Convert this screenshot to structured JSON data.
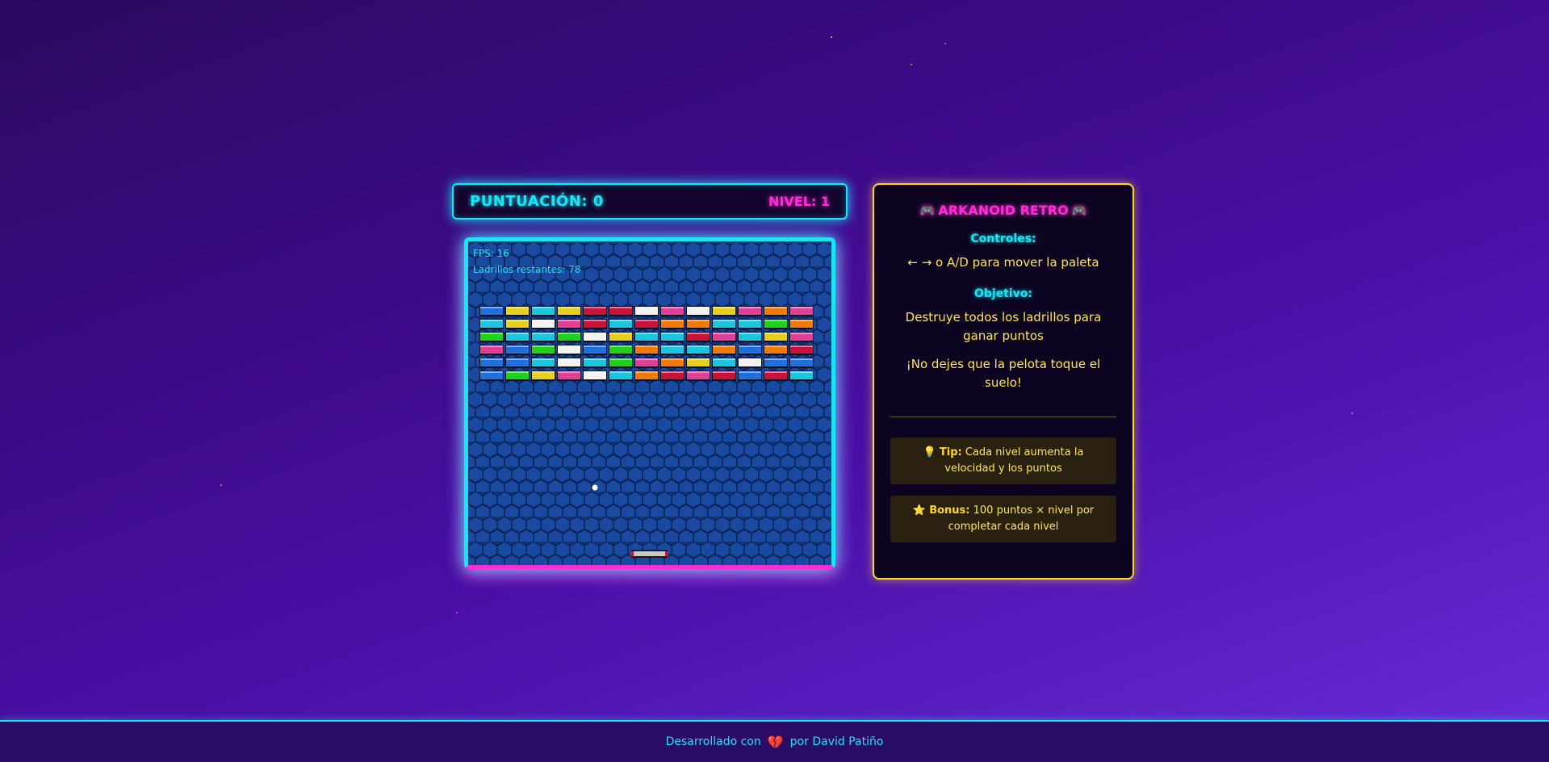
{
  "header": {
    "score_label": "PUNTUACIÓN: 0",
    "level_label": "NIVEL: 1"
  },
  "game": {
    "fps_label": "FPS: 16",
    "bricks_label": "Ladrillos restantes: 78",
    "brick_rows": [
      [
        "blue",
        "yellow",
        "cyan",
        "yellow",
        "red",
        "red",
        "white",
        "pink",
        "white",
        "yellow",
        "pink",
        "orange",
        "pink"
      ],
      [
        "cyan",
        "yellow",
        "white",
        "pink",
        "red",
        "cyan",
        "red",
        "orange",
        "orange",
        "cyan",
        "cyan",
        "green",
        "orange"
      ],
      [
        "green",
        "cyan",
        "cyan",
        "green",
        "white",
        "yellow",
        "cyan",
        "cyan",
        "red",
        "pink",
        "cyan",
        "yellow",
        "pink"
      ],
      [
        "pink",
        "blue",
        "green",
        "white",
        "blue",
        "green",
        "orange",
        "cyan",
        "cyan",
        "orange",
        "blue",
        "orange",
        "red"
      ],
      [
        "blue",
        "blue",
        "cyan",
        "white",
        "cyan",
        "green",
        "pink",
        "orange",
        "yellow",
        "cyan",
        "white",
        "blue",
        "blue"
      ],
      [
        "blue",
        "green",
        "yellow",
        "pink",
        "white",
        "cyan",
        "orange",
        "red",
        "pink",
        "red",
        "blue",
        "red",
        "cyan"
      ]
    ],
    "ball_color": "#ffffff",
    "paddle_color": "#c8c8c8"
  },
  "info": {
    "title": "ARKANOID RETRO",
    "title_icon": "gamepad-icon",
    "controls_title": "Controles:",
    "controls_text": "← → o A/D para mover la paleta",
    "objective_title": "Objetivo:",
    "objective_text_1": "Destruye todos los ladrillos para ganar puntos",
    "objective_text_2": "¡No dejes que la pelota toque el suelo!",
    "tip_icon": "lightbulb-icon",
    "tip_label": "Tip:",
    "tip_text": "Cada nivel aumenta la velocidad y los puntos",
    "bonus_icon": "star-icon",
    "bonus_label": "Bonus:",
    "bonus_text": "100 puntos × nivel por completar cada nivel"
  },
  "footer": {
    "text_before": "Desarrollado con",
    "heart_icon": "heart-icon",
    "text_after": "por David Patiño"
  },
  "colors": {
    "cyan": "#19e6f5",
    "magenta": "#ff2bd6",
    "yellow": "#ffd71f",
    "brick_blue": "#1e6fe0",
    "brick_yellow": "#e6d21e",
    "brick_cyan": "#19c8e0",
    "brick_red": "#c8143c",
    "brick_white": "#f2f2f2",
    "brick_pink": "#e0409a",
    "brick_orange": "#f07a0a",
    "brick_green": "#1ed21e"
  }
}
